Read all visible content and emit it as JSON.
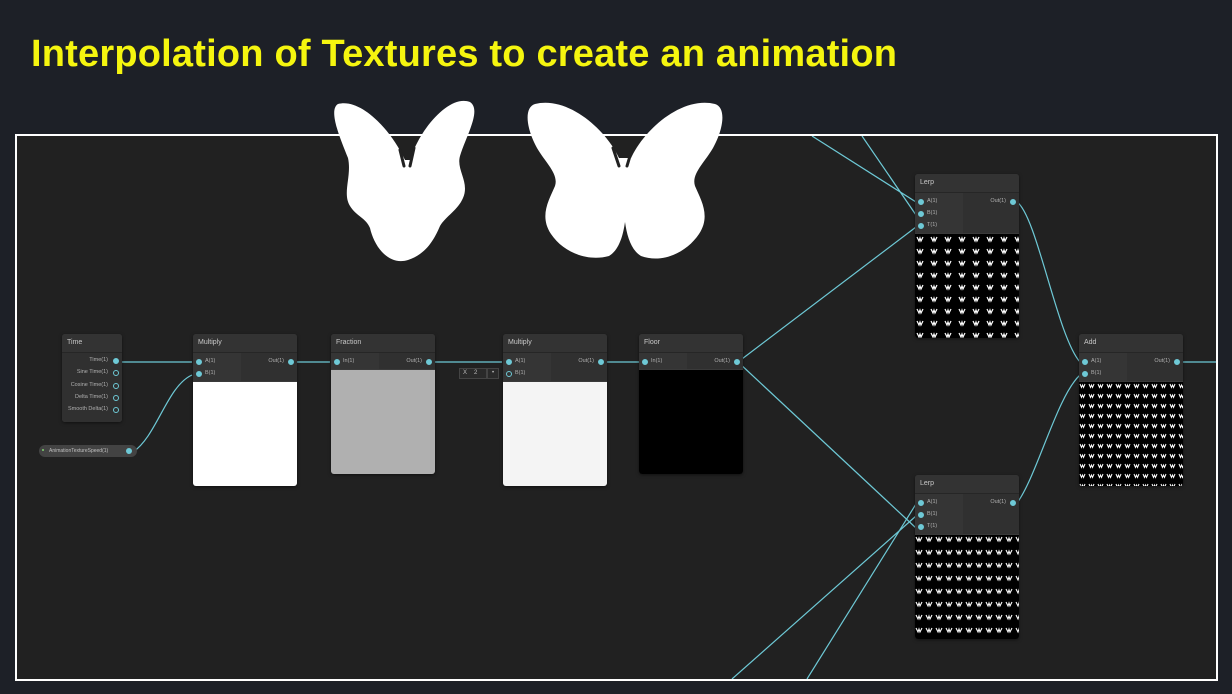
{
  "title": "Interpolation of Textures to create an animation",
  "colors": {
    "title": "#f5f50f",
    "background": "#1d2027",
    "graph": "#212121",
    "wire": "#6ec9d6",
    "frame_border": "#ffffff"
  },
  "nodes": {
    "time": {
      "header": "Time",
      "outputs": [
        "Time(1)",
        "Sine Time(1)",
        "Cosine Time(1)",
        "Delta Time(1)",
        "Smooth Delta(1)"
      ]
    },
    "property": {
      "label": "AnimationTextureSpeed(1)"
    },
    "multiply1": {
      "header": "Multiply",
      "in_a": "A(1)",
      "in_b": "B(1)",
      "out": "Out(1)",
      "preview": "white"
    },
    "fraction": {
      "header": "Fraction",
      "in": "In(1)",
      "out": "Out(1)",
      "preview": "gray"
    },
    "multiply2": {
      "header": "Multiply",
      "in_a": "A(1)",
      "in_b": "B(1)",
      "out": "Out(1)",
      "preview": "light",
      "inline_axis": "X",
      "inline_value": "2"
    },
    "floor": {
      "header": "Floor",
      "in": "In(1)",
      "out": "Out(1)",
      "preview": "black"
    },
    "lerp1": {
      "header": "Lerp",
      "in_a": "A(1)",
      "in_b": "B(1)",
      "in_t": "T(1)",
      "out": "Out(1)",
      "preview": "butterfly-pattern"
    },
    "lerp2": {
      "header": "Lerp",
      "in_a": "A(1)",
      "in_b": "B(1)",
      "in_t": "T(1)",
      "out": "Out(1)",
      "preview": "butterfly-pattern"
    },
    "add": {
      "header": "Add",
      "in_a": "A(1)",
      "in_b": "B(1)",
      "out": "Out(1)",
      "preview": "butterfly-pattern"
    }
  },
  "butterflies": [
    {
      "name": "butterfly-wings-closed-icon"
    },
    {
      "name": "butterfly-wings-open-icon"
    }
  ]
}
